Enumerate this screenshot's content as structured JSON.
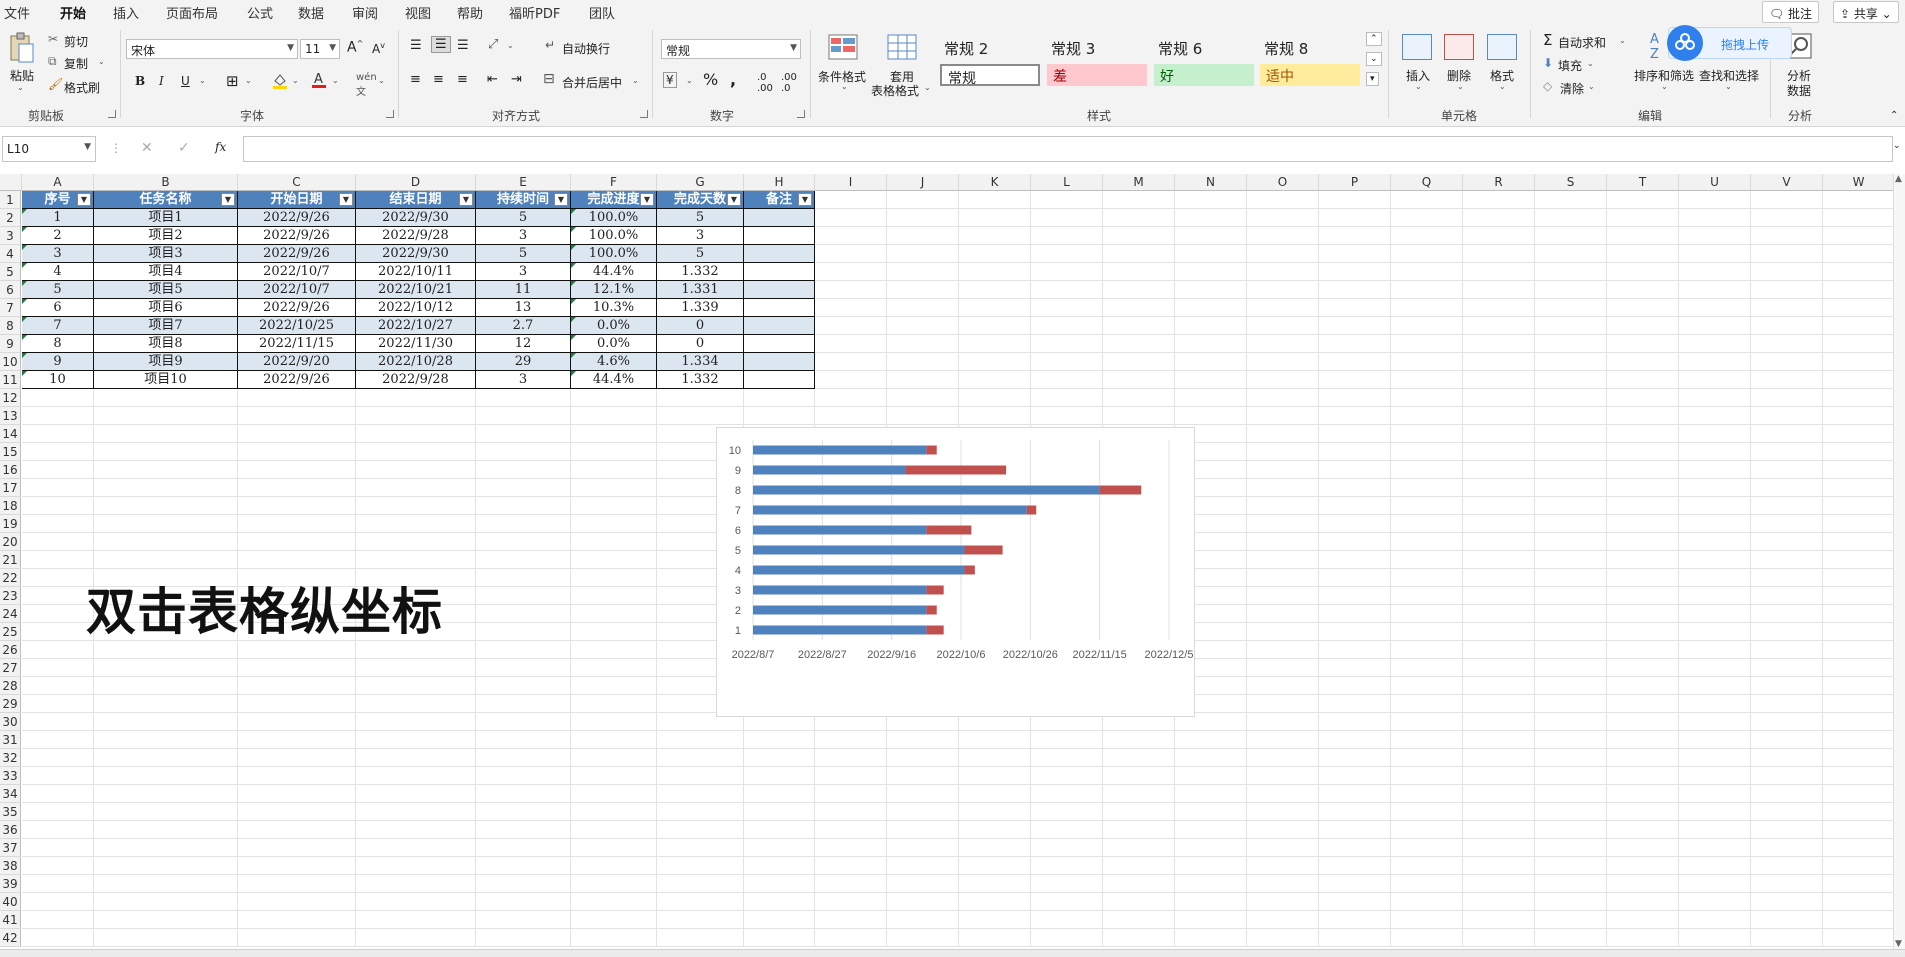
{
  "menu": {
    "tabs": [
      "文件",
      "开始",
      "插入",
      "页面布局",
      "公式",
      "数据",
      "审阅",
      "视图",
      "帮助",
      "福昕PDF",
      "团队"
    ],
    "active_tab": "开始",
    "comment_label": "批注",
    "share_label": "共享"
  },
  "ribbon": {
    "clipboard": {
      "paste": "粘贴",
      "cut": "剪切",
      "copy": "复制",
      "format_painter": "格式刷",
      "label": "剪贴板"
    },
    "font": {
      "name": "宋体",
      "size": "11",
      "bold": "B",
      "italic": "I",
      "underline": "U",
      "label": "字体"
    },
    "alignment": {
      "wrap": "自动换行",
      "merge": "合并后居中",
      "label": "对齐方式"
    },
    "number": {
      "format": "常规",
      "label": "数字"
    },
    "styles": {
      "conditional": "条件格式",
      "table_format_1": "套用",
      "table_format_2": "表格格式",
      "cells": [
        "常规 2",
        "常规 3",
        "常规 6",
        "常规 8",
        "常规",
        "差",
        "好",
        "适中"
      ],
      "label": "样式"
    },
    "cells": {
      "insert": "插入",
      "delete": "删除",
      "format": "格式",
      "label": "单元格"
    },
    "editing": {
      "autosum": "自动求和",
      "fill": "填充",
      "clear": "清除",
      "sort_filter": "排序和筛选",
      "find_select": "查找和选择",
      "label": "编辑"
    },
    "analysis": {
      "analyze_1": "分析",
      "analyze_2": "数据",
      "label": "分析"
    },
    "upload_popup": "拖拽上传"
  },
  "formula_bar": {
    "name_box": "L10",
    "formula": ""
  },
  "sheet": {
    "columns": [
      "A",
      "B",
      "C",
      "D",
      "E",
      "F",
      "G",
      "H",
      "I",
      "J",
      "K",
      "L",
      "M",
      "N",
      "O",
      "P",
      "Q",
      "R",
      "S",
      "T",
      "U",
      "V",
      "W"
    ],
    "rows": [
      "1",
      "2",
      "3",
      "4",
      "5",
      "6",
      "7",
      "8",
      "9",
      "10",
      "11",
      "12",
      "13",
      "14",
      "15",
      "16",
      "17",
      "18",
      "19",
      "20",
      "21",
      "22",
      "23",
      "24",
      "25",
      "26",
      "27",
      "28",
      "29",
      "30",
      "31",
      "32",
      "33",
      "34",
      "35",
      "36",
      "37",
      "38",
      "39",
      "40",
      "41",
      "42"
    ],
    "table_headers": [
      "序号",
      "任务名称",
      "开始日期",
      "结束日期",
      "持续时间",
      "完成进度",
      "完成天数",
      "备注"
    ],
    "table_rows": [
      [
        "1",
        "项目1",
        "2022/9/26",
        "2022/9/30",
        "5",
        "100.0%",
        "5",
        ""
      ],
      [
        "2",
        "项目2",
        "2022/9/26",
        "2022/9/28",
        "3",
        "100.0%",
        "3",
        ""
      ],
      [
        "3",
        "项目3",
        "2022/9/26",
        "2022/9/30",
        "5",
        "100.0%",
        "5",
        ""
      ],
      [
        "4",
        "项目4",
        "2022/10/7",
        "2022/10/11",
        "3",
        "44.4%",
        "1.332",
        ""
      ],
      [
        "5",
        "项目5",
        "2022/10/7",
        "2022/10/21",
        "11",
        "12.1%",
        "1.331",
        ""
      ],
      [
        "6",
        "项目6",
        "2022/9/26",
        "2022/10/12",
        "13",
        "10.3%",
        "1.339",
        ""
      ],
      [
        "7",
        "项目7",
        "2022/10/25",
        "2022/10/27",
        "2.7",
        "0.0%",
        "0",
        ""
      ],
      [
        "8",
        "项目8",
        "2022/11/15",
        "2022/11/30",
        "12",
        "0.0%",
        "0",
        ""
      ],
      [
        "9",
        "项目9",
        "2022/9/20",
        "2022/10/28",
        "29",
        "4.6%",
        "1.334",
        ""
      ],
      [
        "10",
        "项目10",
        "2022/9/26",
        "2022/9/28",
        "3",
        "44.4%",
        "1.332",
        ""
      ]
    ],
    "annotation_text": "双击表格纵坐标",
    "colors": {
      "header_bg": "#4f81bd",
      "band_bg": "#dce6f1",
      "accent_green": "#217346"
    }
  },
  "chart_data": {
    "type": "bar",
    "orientation": "horizontal",
    "stacked": true,
    "categories": [
      "1",
      "2",
      "3",
      "4",
      "5",
      "6",
      "7",
      "8",
      "9",
      "10"
    ],
    "series": [
      {
        "values": [
          "2022/9/26",
          "2022/9/26",
          "2022/9/26",
          "2022/10/7",
          "2022/10/7",
          "2022/9/26",
          "2022/10/25",
          "2022/11/15",
          "2022/9/20",
          "2022/9/26"
        ],
        "color": "#4f81bd"
      },
      {
        "values": [
          5,
          3,
          5,
          3,
          11,
          13,
          2.7,
          12,
          29,
          3
        ],
        "color": "#c0504d"
      }
    ],
    "x_tick_labels": [
      "2022/8/7",
      "2022/8/27",
      "2022/9/16",
      "2022/10/6",
      "2022/10/26",
      "2022/11/15",
      "2022/12/5"
    ],
    "xlim": [
      "2022/8/7",
      "2022/12/5"
    ],
    "grid": true,
    "legend": "none"
  }
}
